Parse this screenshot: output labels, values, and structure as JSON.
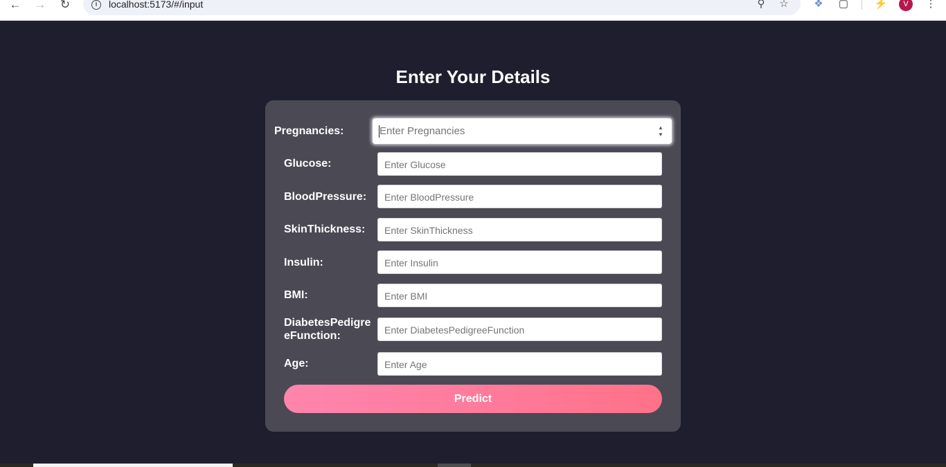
{
  "browser": {
    "url": "localhost:5173/#/input",
    "avatar_letter": "V",
    "icons": [
      "back-arrow-icon",
      "forward-arrow-icon",
      "reload-icon",
      "info-icon",
      "zoom-icon",
      "star-icon",
      "extension-icon",
      "puzzle-icon",
      "performance-icon",
      "menu-dots-icon"
    ]
  },
  "page": {
    "title": "Enter Your Details"
  },
  "form": {
    "fields": [
      {
        "label": "Pregnancies:",
        "placeholder": "Enter Pregnancies"
      },
      {
        "label": "Glucose:",
        "placeholder": "Enter Glucose"
      },
      {
        "label": "BloodPressure:",
        "placeholder": "Enter BloodPressure"
      },
      {
        "label": "SkinThickness:",
        "placeholder": "Enter SkinThickness"
      },
      {
        "label": "Insulin:",
        "placeholder": "Enter Insulin"
      },
      {
        "label": "BMI:",
        "placeholder": "Enter BMI"
      },
      {
        "label": "DiabetesPedigre eFunction:",
        "placeholder": "Enter DiabetesPedigreeFunction"
      },
      {
        "label": "Age:",
        "placeholder": "Enter Age"
      }
    ],
    "submit_label": "Predict"
  },
  "colors": {
    "page_bg": "#1f1e2e",
    "card_bg": "#4a4954",
    "button_gradient_start": "#ff85ad",
    "button_gradient_end": "#ff7288"
  }
}
